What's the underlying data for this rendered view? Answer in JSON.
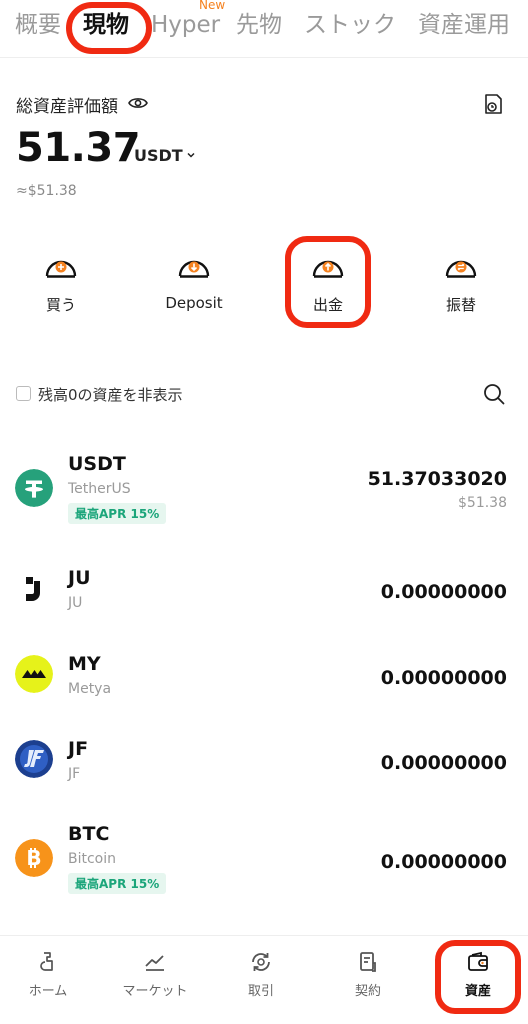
{
  "tabs": [
    {
      "label": "概要"
    },
    {
      "label": "現物"
    },
    {
      "label": "Hyper"
    },
    {
      "label": "先物"
    },
    {
      "label": "ストック"
    },
    {
      "label": "資産運用"
    }
  ],
  "new_badge": "New",
  "balance": {
    "label": "総資産評価額",
    "value": "51.37",
    "unit": "USDT",
    "fiat": "≈$51.38"
  },
  "actions": [
    {
      "label": "買う",
      "icon": "plus-icon"
    },
    {
      "label": "Deposit",
      "icon": "arrow-down-icon"
    },
    {
      "label": "出金",
      "icon": "arrow-up-icon"
    },
    {
      "label": "振替",
      "icon": "transfer-icon"
    }
  ],
  "filter": {
    "label": "残高0の資産を非表示",
    "checked": false
  },
  "assets": [
    {
      "symbol": "USDT",
      "name": "TetherUS",
      "amount": "51.37033020",
      "fiat": "$51.38",
      "apr": "最高APR 15%",
      "icon": "tether-icon"
    },
    {
      "symbol": "JU",
      "name": "JU",
      "amount": "0.00000000",
      "icon": "ju-icon"
    },
    {
      "symbol": "MY",
      "name": "Metya",
      "amount": "0.00000000",
      "icon": "metya-icon"
    },
    {
      "symbol": "JF",
      "name": "JF",
      "amount": "0.00000000",
      "icon": "jf-icon"
    },
    {
      "symbol": "BTC",
      "name": "Bitcoin",
      "amount": "0.00000000",
      "apr": "最高APR 15%",
      "icon": "bitcoin-icon"
    }
  ],
  "nav": [
    {
      "label": "ホーム",
      "icon": "home-icon"
    },
    {
      "label": "マーケット",
      "icon": "market-icon"
    },
    {
      "label": "取引",
      "icon": "trade-icon"
    },
    {
      "label": "契約",
      "icon": "contract-icon"
    },
    {
      "label": "資産",
      "icon": "wallet-icon"
    }
  ],
  "colors": {
    "accent": "#f58220",
    "highlight": "#f02a12",
    "apr_green": "#1ba57a",
    "tether": "#26a17b",
    "btc": "#f7931a",
    "metya": "#e6f21a"
  }
}
